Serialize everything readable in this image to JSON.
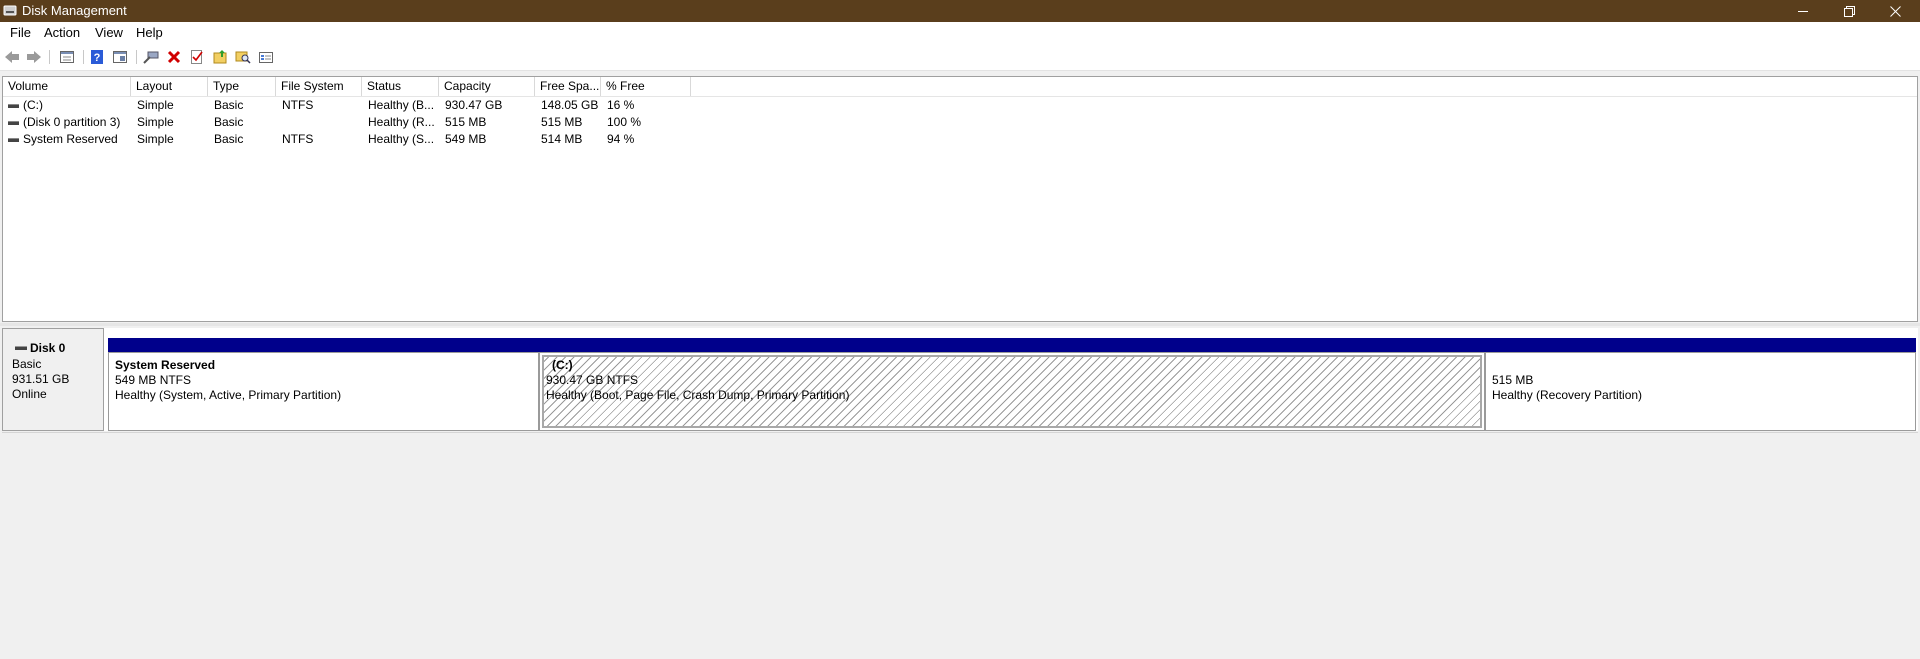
{
  "window": {
    "title": "Disk Management",
    "controls": [
      "minimize",
      "restore",
      "close"
    ]
  },
  "menu": {
    "items": [
      {
        "label": "File"
      },
      {
        "label": "Action"
      },
      {
        "label": "View"
      },
      {
        "label": "Help"
      }
    ]
  },
  "toolbar": {
    "buttons": [
      "back-icon",
      "forward-icon",
      "list-view-icon",
      "help-icon",
      "properties-icon",
      "connect-icon",
      "delete-icon",
      "check-icon",
      "new-folder-icon",
      "search-folder-icon",
      "settings-panel-icon"
    ]
  },
  "volumes": {
    "columns": [
      "Volume",
      "Layout",
      "Type",
      "File System",
      "Status",
      "Capacity",
      "Free Spa...",
      "% Free"
    ],
    "rows": [
      {
        "volume": "(C:)",
        "layout": "Simple",
        "type": "Basic",
        "fs": "NTFS",
        "status": "Healthy (B...",
        "capacity": "930.47 GB",
        "free": "148.05 GB",
        "pct": "16 %"
      },
      {
        "volume": "(Disk 0 partition 3)",
        "layout": "Simple",
        "type": "Basic",
        "fs": "",
        "status": "Healthy (R...",
        "capacity": "515 MB",
        "free": "515 MB",
        "pct": "100 %"
      },
      {
        "volume": "System Reserved",
        "layout": "Simple",
        "type": "Basic",
        "fs": "NTFS",
        "status": "Healthy (S...",
        "capacity": "549 MB",
        "free": "514 MB",
        "pct": "94 %"
      }
    ]
  },
  "disk": {
    "name": "Disk 0",
    "type": "Basic",
    "size": "931.51 GB",
    "state": "Online",
    "partitions": [
      {
        "title": "System Reserved",
        "size": "549 MB NTFS",
        "status": "Healthy (System, Active, Primary Partition)"
      },
      {
        "title": "(C:)",
        "size": "930.47 GB NTFS",
        "status": "Healthy (Boot, Page File, Crash Dump, Primary Partition)"
      },
      {
        "title": "",
        "size": "515 MB",
        "status": "Healthy (Recovery Partition)"
      }
    ]
  },
  "colors": {
    "titlebar": "#5a3e1c",
    "partition_header": "#00008b",
    "window_bg": "#f0f0f0"
  }
}
